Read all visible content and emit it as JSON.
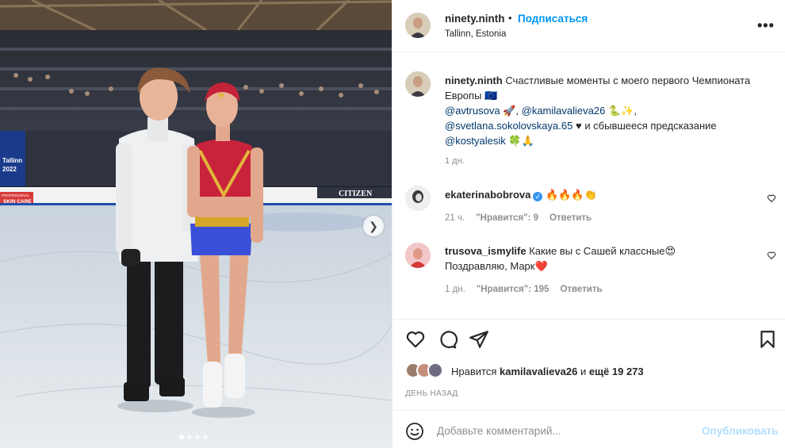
{
  "photo": {
    "banner_city": "Tallinn",
    "banner_year": "2022",
    "ad_left": "SKIN CARE",
    "ad_left_top": "PROFESSIONAL",
    "ad_right": "CITIZEN",
    "carousel_count": 4,
    "carousel_active": 1
  },
  "header": {
    "username": "ninety.ninth",
    "separator": "•",
    "follow_label": "Подписаться",
    "location": "Tallinn, Estonia",
    "more_label": "•••"
  },
  "caption": {
    "username": "ninety.ninth",
    "text_1": "Счастливые моменты с моего первого Чемпионата Европы",
    "flag_emoji": "🇪🇺",
    "mention_1": "@avtrusova",
    "emoji_1": "🚀",
    "sep_1": ",",
    "mention_2": "@kamilavalieva26",
    "emoji_2": "🐍✨",
    "sep_2": ",",
    "mention_3": "@svetlana.sokolovskaya.65",
    "emoji_3": "♥",
    "text_2": "и сбывшееся предсказание",
    "mention_4": "@kostyalesik",
    "emoji_4": "🍀🙏",
    "time": "1 дн."
  },
  "comments": [
    {
      "username": "ekaterinabobrova",
      "verified_mark": "✓",
      "text": "🔥🔥🔥👏",
      "time": "21 ч.",
      "likes_label": "\"Нравится\": 9",
      "reply_label": "Ответить"
    },
    {
      "username": "trusova_ismylife",
      "text": "Какие вы с Сашей классные😍 Поздравляю, Марк❤️",
      "time": "1 дн.",
      "likes_label": "\"Нравится\": 195",
      "reply_label": "Ответить"
    }
  ],
  "actions": {
    "likes_prefix": "Нравится",
    "likes_user": "kamilavalieva26",
    "likes_and": "и",
    "likes_more": "ещё 19 273",
    "date": "ДЕНЬ НАЗАД"
  },
  "compose": {
    "placeholder": "Добавьте комментарий...",
    "post_label": "Опубликовать"
  },
  "colors": {
    "accent": "#0095f6",
    "mention": "#00376b",
    "muted": "#8e8e8e",
    "post_disabled": "#b2dffc"
  }
}
